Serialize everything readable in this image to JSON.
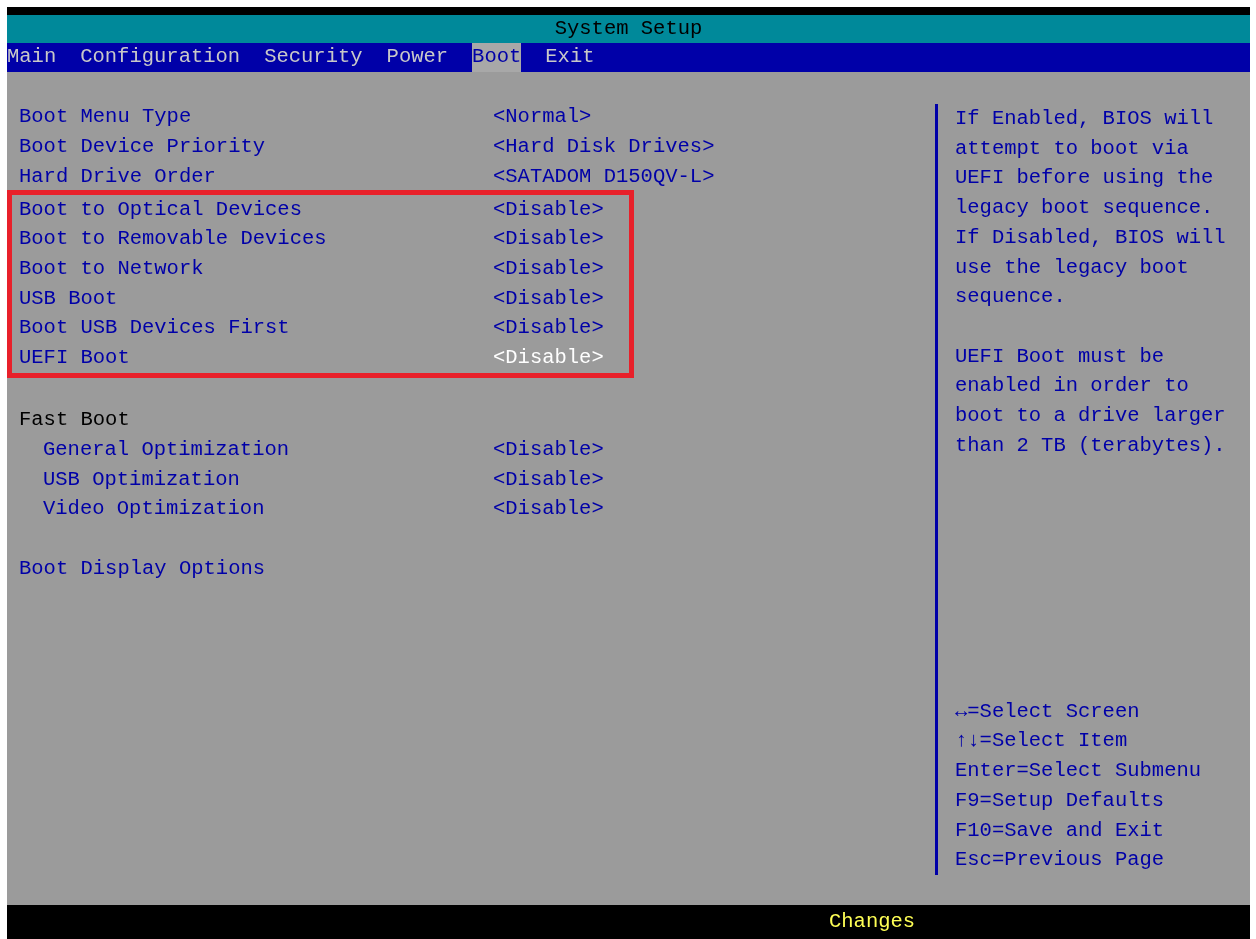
{
  "window": {
    "title": "System Setup"
  },
  "tabs": [
    {
      "label": "Main",
      "selected": false
    },
    {
      "label": "Configuration",
      "selected": false
    },
    {
      "label": "Security",
      "selected": false
    },
    {
      "label": "Power",
      "selected": false
    },
    {
      "label": "Boot",
      "selected": true
    },
    {
      "label": "Exit",
      "selected": false
    }
  ],
  "groups": [
    {
      "outlined": false,
      "items": [
        {
          "kind": "setting",
          "label": "Boot Menu Type",
          "value": "<Normal>",
          "selected": false
        },
        {
          "kind": "setting",
          "label": "Boot Device Priority",
          "value": "<Hard Disk Drives>",
          "selected": false
        },
        {
          "kind": "setting",
          "label": "Hard Drive Order",
          "value": "<SATADOM D150QV-L>",
          "selected": false
        }
      ]
    },
    {
      "outlined": true,
      "items": [
        {
          "kind": "setting",
          "label": "Boot to Optical Devices",
          "value": "<Disable>",
          "selected": false
        },
        {
          "kind": "setting",
          "label": "Boot to Removable Devices",
          "value": "<Disable>",
          "selected": false
        },
        {
          "kind": "setting",
          "label": "Boot to Network",
          "value": "<Disable>",
          "selected": false
        },
        {
          "kind": "setting",
          "label": "USB Boot",
          "value": "<Disable>",
          "selected": false
        },
        {
          "kind": "setting",
          "label": "Boot USB Devices First",
          "value": "<Disable>",
          "selected": false
        },
        {
          "kind": "setting",
          "label": "UEFI Boot",
          "value": "<Disable>",
          "selected": true
        }
      ]
    },
    {
      "outlined": false,
      "items": [
        {
          "kind": "header",
          "label": "Fast Boot",
          "children": [
            {
              "kind": "setting",
              "label": "General Optimization",
              "value": "<Disable>",
              "selected": false
            },
            {
              "kind": "setting",
              "label": "USB Optimization",
              "value": "<Disable>",
              "selected": false
            },
            {
              "kind": "setting",
              "label": "Video Optimization",
              "value": "<Disable>",
              "selected": false
            }
          ]
        }
      ]
    },
    {
      "outlined": false,
      "items": [
        {
          "kind": "submenu",
          "label": "Boot Display Options",
          "selected": false
        }
      ]
    }
  ],
  "help": {
    "paragraphs": [
      "If Enabled, BIOS will attempt to boot via UEFI before using the legacy boot sequence. If Disabled, BIOS will use the legacy boot sequence.",
      "UEFI Boot must be enabled in order to boot to a drive larger than 2 TB (terabytes)."
    ],
    "keys": [
      "↔=Select Screen",
      "↑↓=Select Item",
      "Enter=Select Submenu",
      "F9=Setup Defaults",
      "F10=Save and Exit",
      "Esc=Previous Page"
    ]
  },
  "status_bar": {
    "text": "Changes"
  }
}
